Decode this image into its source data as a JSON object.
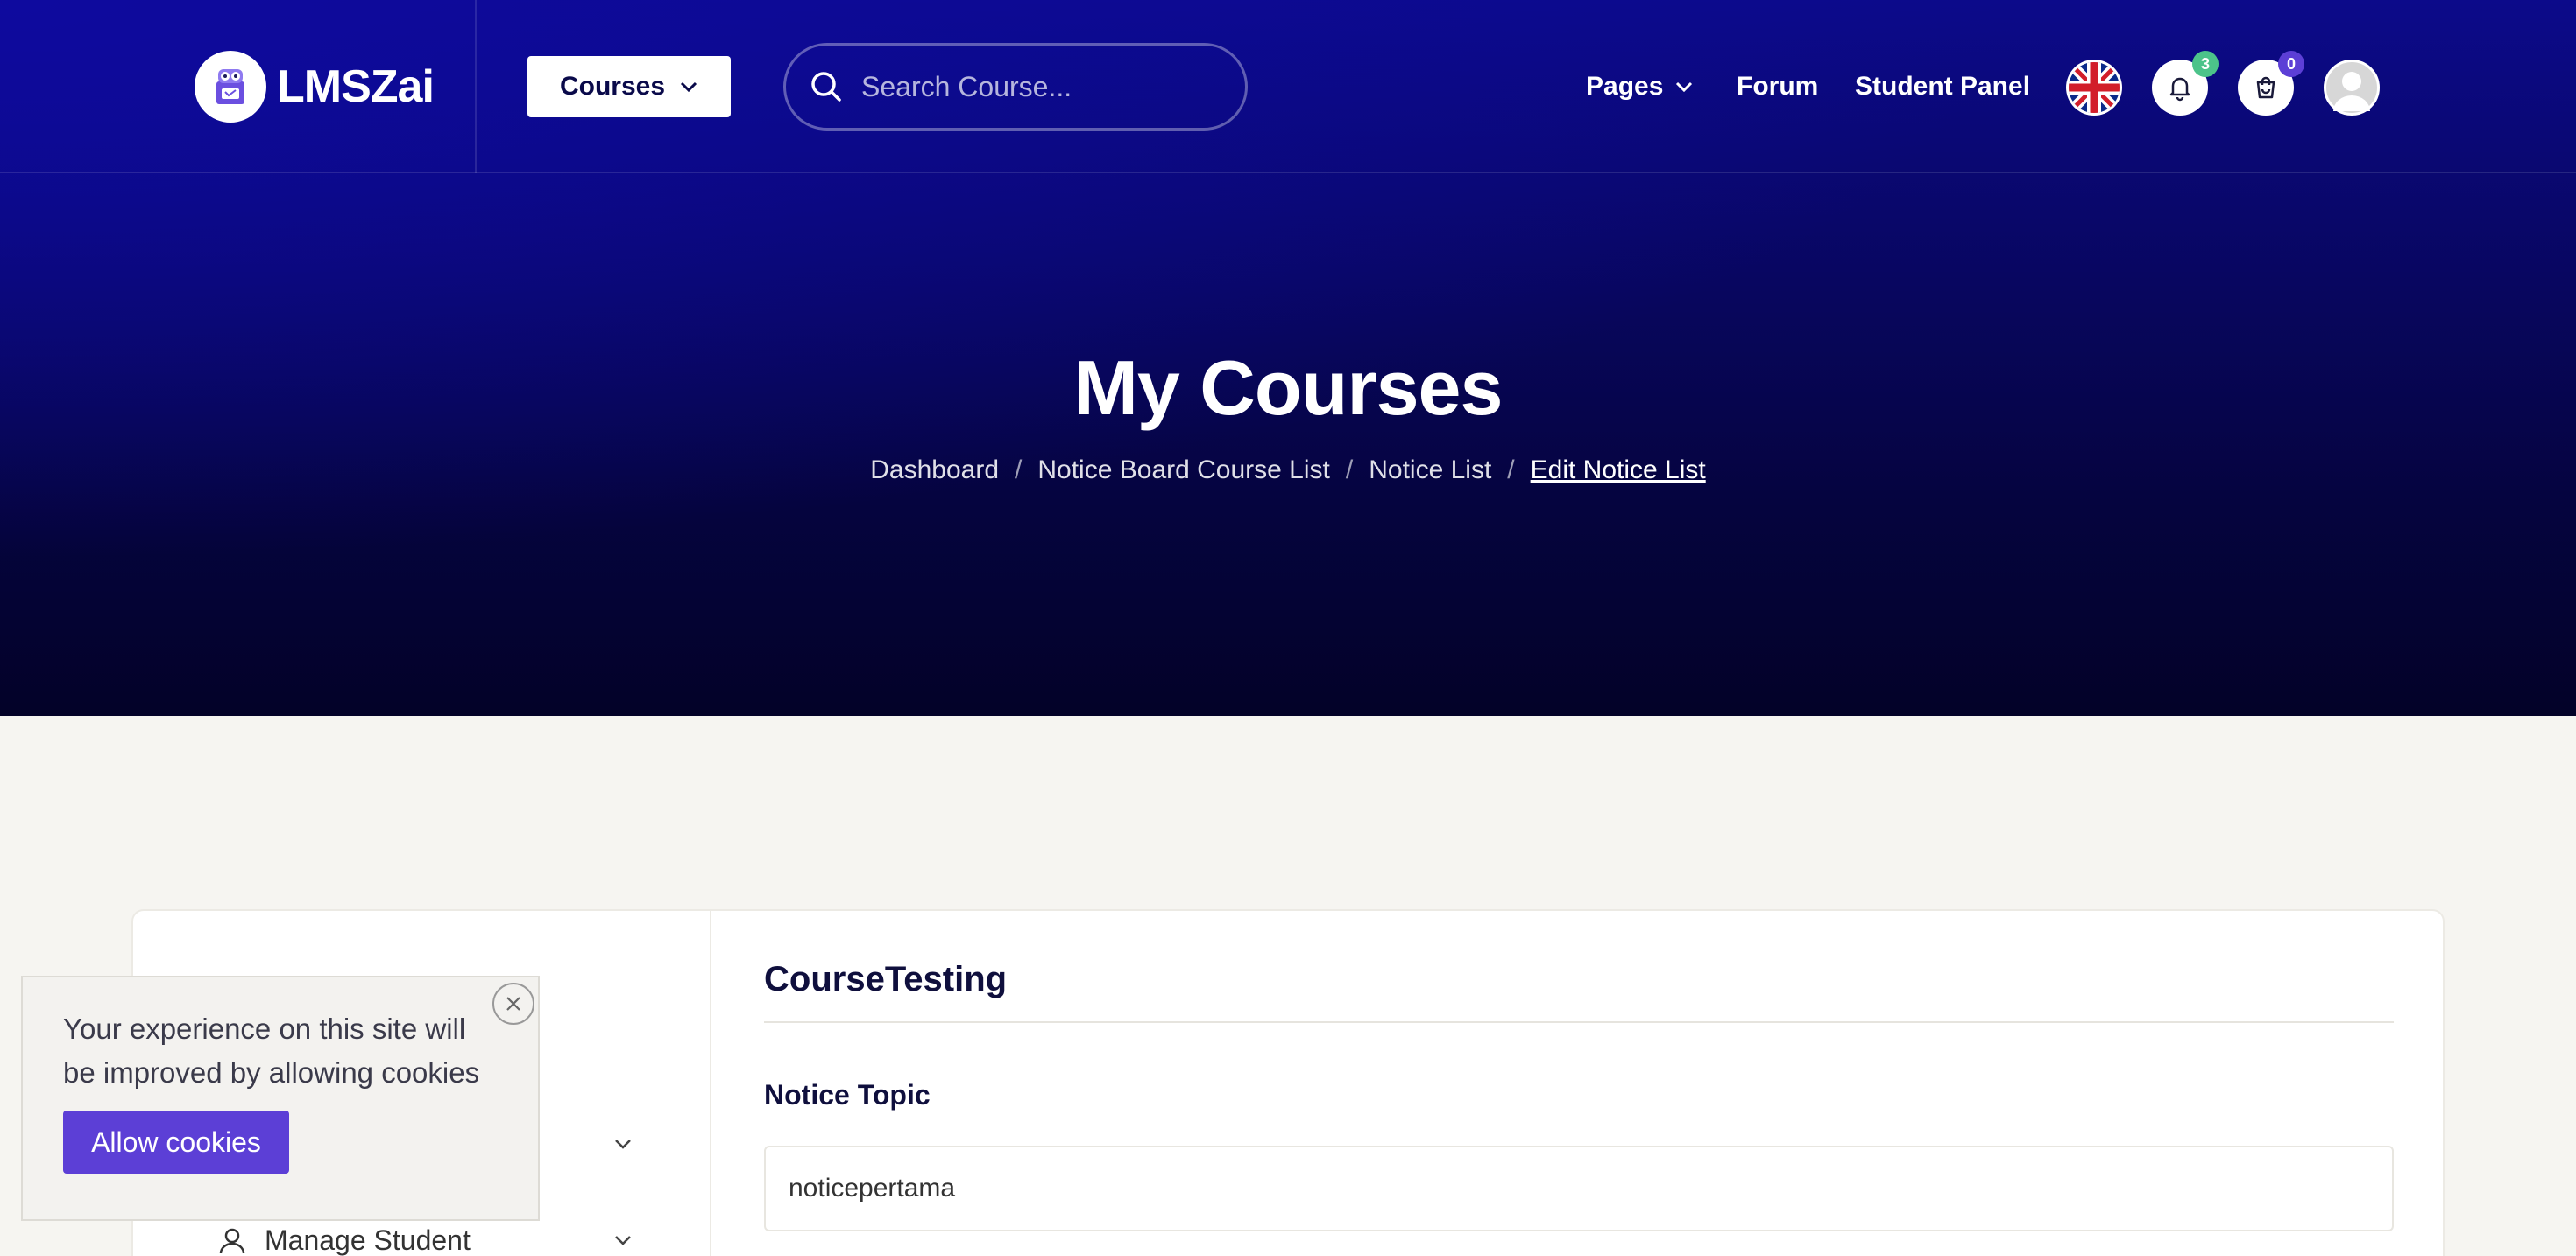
{
  "header": {
    "brand": "LMSZai",
    "courses_button": "Courses",
    "search_placeholder": "Search Course...",
    "nav": {
      "pages": "Pages",
      "forum": "Forum",
      "student_panel": "Student Panel"
    },
    "notification_count": "3",
    "cart_count": "0",
    "icons": [
      "logo-icon",
      "chevron-down-icon",
      "search-icon",
      "uk-flag-icon",
      "bell-icon",
      "cart-icon",
      "avatar"
    ]
  },
  "hero": {
    "title": "My Courses",
    "breadcrumb": [
      "Dashboard",
      "Notice Board Course List",
      "Notice List",
      "Edit Notice List"
    ]
  },
  "sidebar": {
    "items": [
      {
        "label": ""
      },
      {
        "label": "Manage Student"
      }
    ]
  },
  "main": {
    "course_name": "CourseTesting",
    "notice_topic_label": "Notice Topic",
    "notice_topic_value": "noticepertama"
  },
  "cookie": {
    "message": "Your experience on this site will be improved by allowing cookies",
    "button": "Allow cookies"
  },
  "colors": {
    "hero_top": "#0c0a8a",
    "hero_bottom": "#030228",
    "accent": "#5c3fd6",
    "notification_badge": "#4cc38a",
    "cart_badge": "#5c3fd6"
  }
}
